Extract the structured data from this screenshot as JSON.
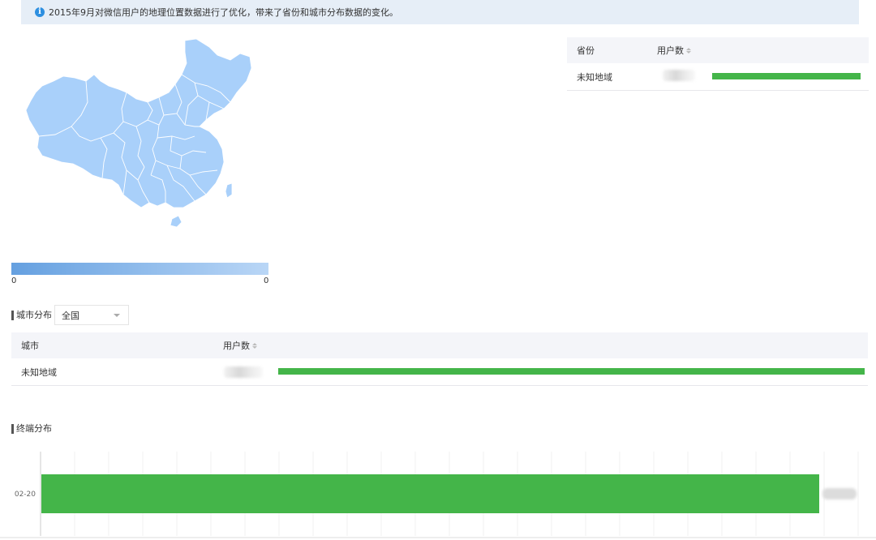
{
  "notice": {
    "icon": "info-icon",
    "text": "2015年9月对微信用户的地理位置数据进行了优化，带来了省份和城市分布数据的变化。"
  },
  "map": {
    "fill_color": "#a9d0fa",
    "border_color": "#ffffff",
    "legend": {
      "min_label": "0",
      "max_label": "0",
      "color_start": "#65a0e0",
      "color_end": "#b9d6f6"
    }
  },
  "province_table": {
    "headers": {
      "province": "省份",
      "users": "用户数"
    },
    "rows": [
      {
        "province": "未知地域",
        "bar_fraction": 1.0
      }
    ]
  },
  "city_section": {
    "title": "城市分布",
    "select_value": "全国",
    "headers": {
      "city": "城市",
      "users": "用户数"
    },
    "rows": [
      {
        "city": "未知地域",
        "bar_fraction": 1.0
      }
    ]
  },
  "terminal_section": {
    "title": "终端分布"
  },
  "chart_data": {
    "type": "bar",
    "orientation": "horizontal",
    "categories": [
      "02-20"
    ],
    "values": [
      1.0
    ],
    "bar_color": "#44b549",
    "grid": true
  },
  "colors": {
    "accent_green": "#44b549",
    "header_bg": "#f4f5f9",
    "notice_bg": "#e6eef7"
  }
}
